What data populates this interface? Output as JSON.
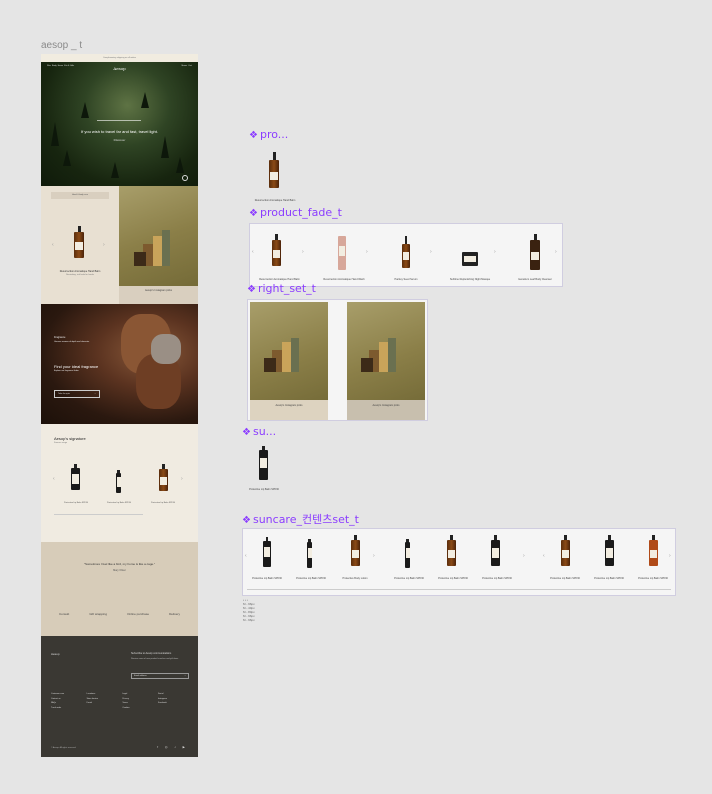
{
  "frame_title": "aesop _ t",
  "page": {
    "announcement": "Complimentary shipping on all orders",
    "nav_left": [
      "Skin",
      "Body",
      "Home",
      "Kits & Gifts"
    ],
    "nav_right": [
      "Stores",
      "Cart"
    ],
    "logo": "Aesop",
    "hero_quote": "If you wish to travel far and fast, travel light.",
    "hero_cta": "Discover",
    "product_tag": "Hand & body care",
    "product_name": "Resurrection Aromatique Hand Balm",
    "product_desc": "Nourishing, rich balm for hands",
    "right_caption": "Aesop's Instagram picks",
    "fragrance_small": "Fragrance",
    "fragrance_desc": "Uncover aromas of depth and character",
    "fragrance_title": "Find your ideal fragrance",
    "fragrance_sub": "Explore our fragrance finder",
    "fragrance_btn": "Take the quiz",
    "signature_title": "Aesop's signature",
    "signature_sub": "Suncare range",
    "signature_items": [
      "Protective Lip Balm SPF30",
      "Protective Lip Balm SPF30",
      "Protective Lip Balm SPF30"
    ],
    "quote": "\"Sometimes I feel like a bird, my home is like a cage.\"",
    "quote_author": "Mary Oliver",
    "quote_links": [
      "Consult",
      "Gift wrapping",
      "Online purchase",
      "Delivery"
    ],
    "footer_logo": "Aesop",
    "footer_news": "Subscribe to Aesop communications",
    "footer_news_sub": "Receive news of new product launches and gift ideas.",
    "footer_input": "Email address",
    "footer_cols": [
      [
        "Customer care",
        "Contact us",
        "FAQs",
        "Track order"
      ],
      [
        "Locations",
        "Store locator",
        "Facial"
      ],
      [
        "Legal",
        "Privacy",
        "Terms",
        "Cookies"
      ],
      [
        "Social",
        "Instagram",
        "Facebook"
      ]
    ],
    "footer_copy": "© Aesop. All rights reserved.",
    "footer_social": "f ◎ ♪ ▶"
  },
  "components": {
    "pro_label": "pro...",
    "pro_name": "Resurrection Aromatique Hand Balm",
    "product_fade_label": "product_fade_t",
    "fade_items": [
      "Resurrection Aromatique Hand Balm",
      "Resurrection Aromatique Hand Wash",
      "Parsley Seed Serum",
      "Sublime Replenishing Night Masque",
      "Geranium Leaf Body Cleanser"
    ],
    "right_set_label": "right_set_t",
    "right_set_caption": "Aesop's Instagram picks",
    "su_label": "su...",
    "su_name": "Protective Lip Balm SPF30",
    "suncare_label": "suncare_컨텐츠set_t",
    "suncare_items": [
      "Protective Lip Balm SPF30",
      "Protective Lip Balm SPF30",
      "Protective Body Lotion",
      "Protective Lip Balm SPF30",
      "Protective Lip Balm SPF30",
      "Protective Lip Balm SPF30",
      "Protective Lip Balm SPF30",
      "Protective Lip Balm SPF30",
      "Protective Lip Balm SPF30"
    ],
    "notes": [
      "M - 96px",
      "M - 40px",
      "M - 80px",
      "M - 96px",
      "M - 96px"
    ]
  },
  "colors": {
    "accent": "#8b3dff",
    "background": "#e5e5e5"
  }
}
